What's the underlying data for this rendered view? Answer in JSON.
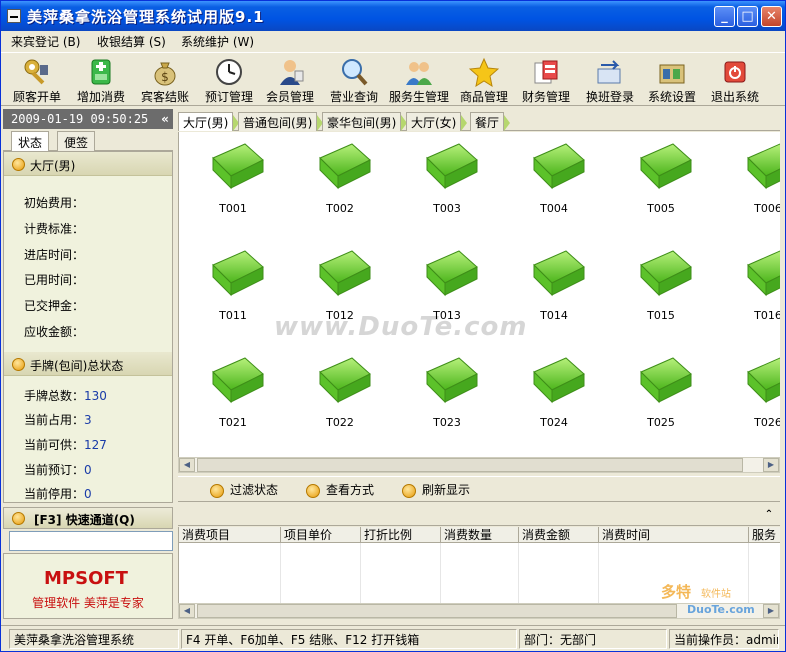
{
  "window": {
    "title": "美萍桑拿洗浴管理系统试用版9.1",
    "minimize_glyph": "_",
    "maximize_glyph": "□",
    "close_glyph": "✕"
  },
  "menu": [
    {
      "label": "来宾登记 (B)"
    },
    {
      "label": "收银结算 (S)"
    },
    {
      "label": "系统维护 (W)"
    }
  ],
  "toolbar": [
    {
      "label": "顾客开单",
      "icon": "key-icon"
    },
    {
      "label": "增加消费",
      "icon": "add-consumption-icon"
    },
    {
      "label": "宾客结账",
      "icon": "money-bag-icon"
    },
    {
      "label": "预订管理",
      "icon": "clock-icon"
    },
    {
      "label": "会员管理",
      "icon": "member-icon"
    },
    {
      "label": "营业查询",
      "icon": "magnifier-icon"
    },
    {
      "label": "服务生管理",
      "icon": "staff-icon"
    },
    {
      "label": "商品管理",
      "icon": "star-icon"
    },
    {
      "label": "财务管理",
      "icon": "finance-icon"
    },
    {
      "label": "换班登录",
      "icon": "shift-icon"
    },
    {
      "label": "系统设置",
      "icon": "settings-icon"
    },
    {
      "label": "退出系统",
      "icon": "power-icon"
    }
  ],
  "left": {
    "datetime": "2009-01-19 09:50:25",
    "collapse_glyph": "«",
    "tabs": [
      "状态",
      "便签"
    ],
    "section1": {
      "title": "大厅(男)",
      "fields": [
        "初始费用：",
        "计费标准：",
        "进店时间：",
        "已用时间：",
        "已交押金：",
        "应收金额："
      ]
    },
    "section2": {
      "title": "手牌(包间)总状态",
      "stats": [
        {
          "label": "手牌总数：",
          "value": "130"
        },
        {
          "label": "当前占用：",
          "value": "3"
        },
        {
          "label": "当前可供：",
          "value": "127"
        },
        {
          "label": "当前预订：",
          "value": "0"
        },
        {
          "label": "当前停用：",
          "value": "0"
        }
      ]
    },
    "quick": {
      "title": "[F3] 快速通道(Q)",
      "value": ""
    },
    "logo": {
      "brand": "MPSOFT",
      "slogan": "管理软件  美萍是专家"
    }
  },
  "room_tabs": [
    "大厅(男)",
    "普通包间(男)",
    "豪华包间(男)",
    "大厅(女)",
    "餐厅"
  ],
  "rooms": [
    [
      "T001",
      "T002",
      "T003",
      "T004",
      "T005",
      "T006"
    ],
    [
      "T011",
      "T012",
      "T013",
      "T014",
      "T015",
      "T016"
    ],
    [
      "T021",
      "T022",
      "T023",
      "T024",
      "T025",
      "T026"
    ]
  ],
  "actions": [
    {
      "label": "过滤状态",
      "icon": "filter-icon"
    },
    {
      "label": "查看方式",
      "icon": "view-icon"
    },
    {
      "label": "刷新显示",
      "icon": "refresh-icon"
    }
  ],
  "grid_columns": [
    "消费项目",
    "项目单价",
    "打折比例",
    "消费数量",
    "消费金额",
    "消费时间",
    "服务"
  ],
  "status": {
    "app": "美萍桑拿洗浴管理系统",
    "hotkeys": "F4 开单、F6加单、F5 结账、F12 打开钱箱",
    "department": "部门：无部门",
    "operator": "当前操作员：admin"
  },
  "watermark": "www.DuoTe.com",
  "watermark2": {
    "line1": "多特",
    "line2": "软件站",
    "line3": "DuoTe.com"
  },
  "colors": {
    "titlebar": "#0054E3",
    "folder_green": "#7FD53A",
    "logo_red": "#C81010",
    "value_blue": "#1A3CA8"
  }
}
